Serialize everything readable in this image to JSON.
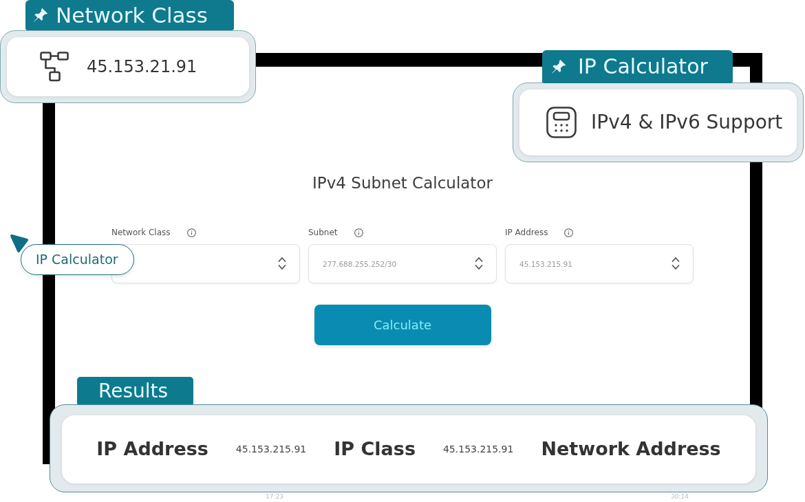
{
  "callouts": [
    {
      "tag": "Network Class",
      "text": "45.153.21.91"
    },
    {
      "tag": "IP Calculator",
      "text": "IPv4 & IPv6 Support"
    }
  ],
  "calculator": {
    "title": "IPv4 Subnet Calculator",
    "fields": [
      {
        "label": "Network Class"
      },
      {
        "label": "Subnet",
        "placeholder": "277.688.255.252/30"
      },
      {
        "label": "IP Address",
        "placeholder": "45.153.215.91"
      }
    ],
    "button": "Calculate"
  },
  "pill": {
    "label": "IP Calculator"
  },
  "results": {
    "tag": "Results",
    "items": [
      {
        "label": "IP Address",
        "value": "45.153.215.91"
      },
      {
        "label": "IP Class",
        "value": "45.153.215.91"
      },
      {
        "label": "Network Address"
      }
    ]
  },
  "time_labels": [
    "17:23",
    "30:14"
  ]
}
